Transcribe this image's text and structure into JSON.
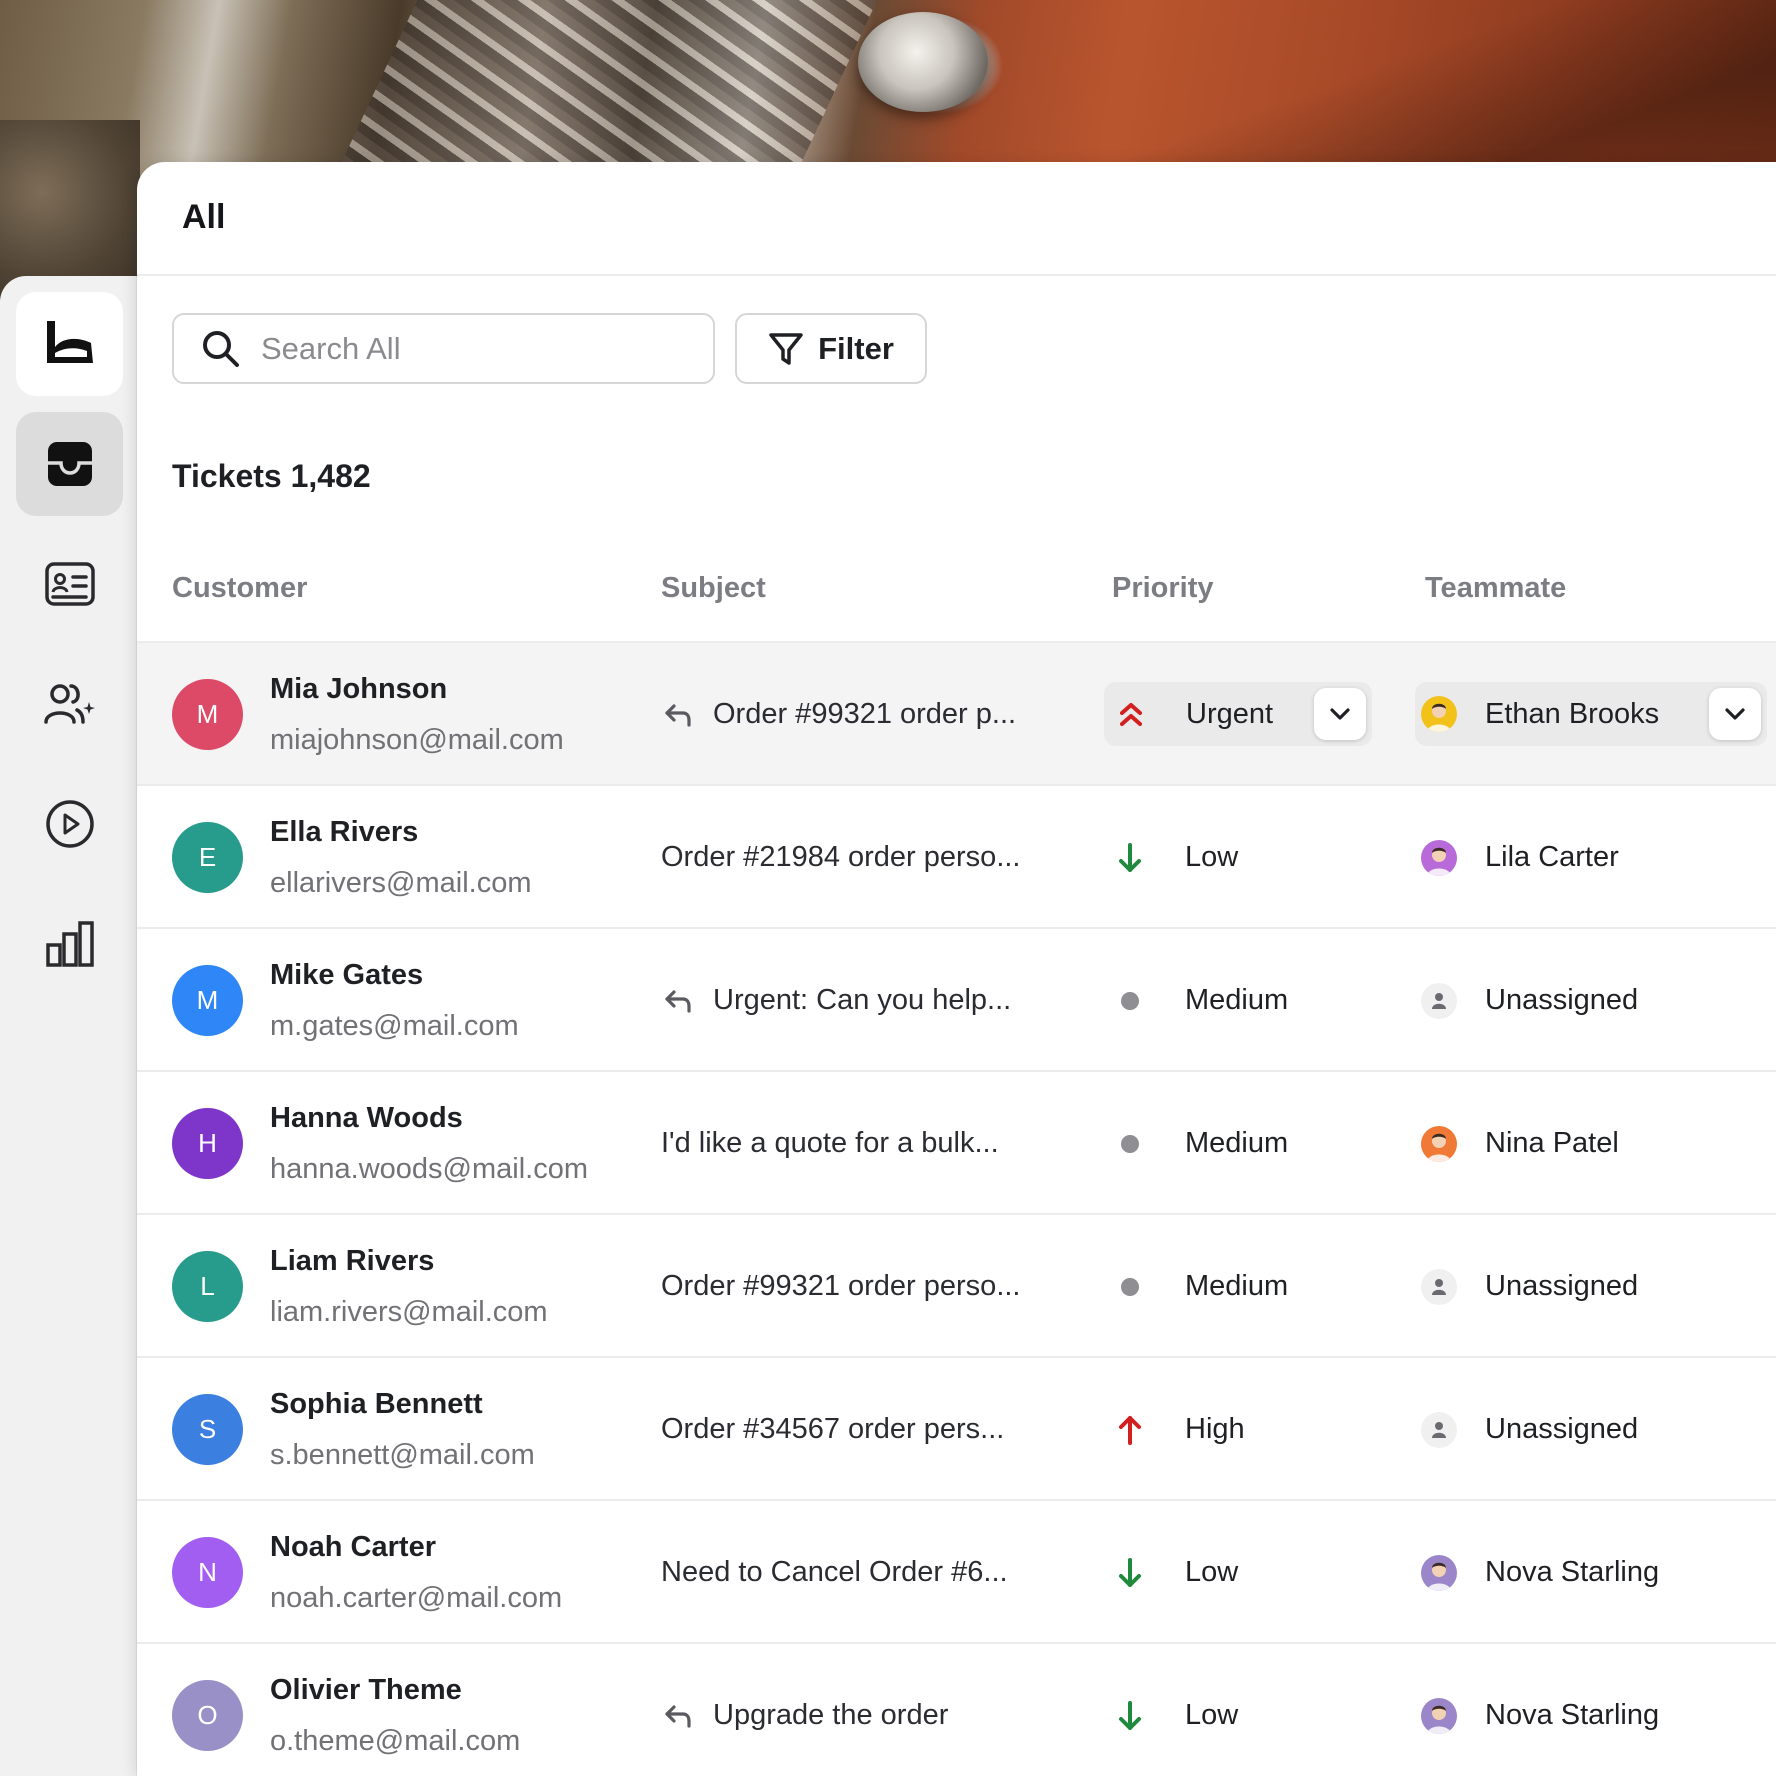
{
  "page": {
    "title": "All",
    "search_placeholder": "Search All",
    "filter_label": "Filter",
    "tickets_label": "Tickets 1,482"
  },
  "columns": [
    "Customer",
    "Subject",
    "Priority",
    "Teammate"
  ],
  "sidebar": {
    "items": [
      {
        "name": "logo",
        "icon": "brand-logo-icon"
      },
      {
        "name": "inbox",
        "icon": "inbox-icon",
        "active": true
      },
      {
        "name": "contacts",
        "icon": "contact-card-icon"
      },
      {
        "name": "team",
        "icon": "add-users-icon"
      },
      {
        "name": "play",
        "icon": "play-circle-icon"
      },
      {
        "name": "reports",
        "icon": "bar-chart-icon"
      }
    ]
  },
  "colors": {
    "urgent": "#d21f1f",
    "high": "#d21f1f",
    "low": "#1f8a3d",
    "medium": "#8e8e93"
  },
  "tickets": [
    {
      "initial": "M",
      "avatar_color": "#dd4a67",
      "name": "Mia Johnson",
      "email": "miajohnson@mail.com",
      "reply": true,
      "subject": "Order #99321 order p...",
      "priority": "Urgent",
      "priority_icon": "double-chevron-up-icon",
      "teammate": "Ethan Brooks",
      "teammate_avatar": "#f2c21b",
      "assigned": true,
      "highlight": true
    },
    {
      "initial": "E",
      "avatar_color": "#279c8c",
      "name": "Ella Rivers",
      "email": "ellarivers@mail.com",
      "reply": false,
      "subject": "Order #21984 order perso...",
      "priority": "Low",
      "priority_icon": "arrow-down-icon",
      "teammate": "Lila Carter",
      "teammate_avatar": "#b86ad9",
      "assigned": true
    },
    {
      "initial": "M",
      "avatar_color": "#2f86f6",
      "name": "Mike Gates",
      "email": "m.gates@mail.com",
      "reply": true,
      "subject": "Urgent: Can you help...",
      "priority": "Medium",
      "priority_icon": "dot-icon",
      "teammate": "Unassigned",
      "teammate_avatar": "#f0f0f0",
      "assigned": false
    },
    {
      "initial": "H",
      "avatar_color": "#7d36c9",
      "name": "Hanna Woods",
      "email": "hanna.woods@mail.com",
      "reply": false,
      "subject": "I'd like a quote for a bulk...",
      "priority": "Medium",
      "priority_icon": "dot-icon",
      "teammate": "Nina Patel",
      "teammate_avatar": "#f07a35",
      "assigned": true
    },
    {
      "initial": "L",
      "avatar_color": "#279c8c",
      "name": "Liam Rivers",
      "email": "liam.rivers@mail.com",
      "reply": false,
      "subject": "Order #99321 order perso...",
      "priority": "Medium",
      "priority_icon": "dot-icon",
      "teammate": "Unassigned",
      "teammate_avatar": "#f0f0f0",
      "assigned": false
    },
    {
      "initial": "S",
      "avatar_color": "#3b7fe0",
      "name": "Sophia Bennett",
      "email": "s.bennett@mail.com",
      "reply": false,
      "subject": "Order #34567 order pers...",
      "priority": "High",
      "priority_icon": "arrow-up-icon",
      "teammate": "Unassigned",
      "teammate_avatar": "#f0f0f0",
      "assigned": false
    },
    {
      "initial": "N",
      "avatar_color": "#a25ef0",
      "name": "Noah Carter",
      "email": "noah.carter@mail.com",
      "reply": false,
      "subject": "Need to Cancel Order #6...",
      "priority": "Low",
      "priority_icon": "arrow-down-icon",
      "teammate": "Nova Starling",
      "teammate_avatar": "#9b86c9",
      "assigned": true
    },
    {
      "initial": "O",
      "avatar_color": "#9890c6",
      "name": "Olivier Theme",
      "email": "o.theme@mail.com",
      "reply": true,
      "subject": "Upgrade the order",
      "priority": "Low",
      "priority_icon": "arrow-down-icon",
      "teammate": "Nova Starling",
      "teammate_avatar": "#9b86c9",
      "assigned": true
    }
  ]
}
